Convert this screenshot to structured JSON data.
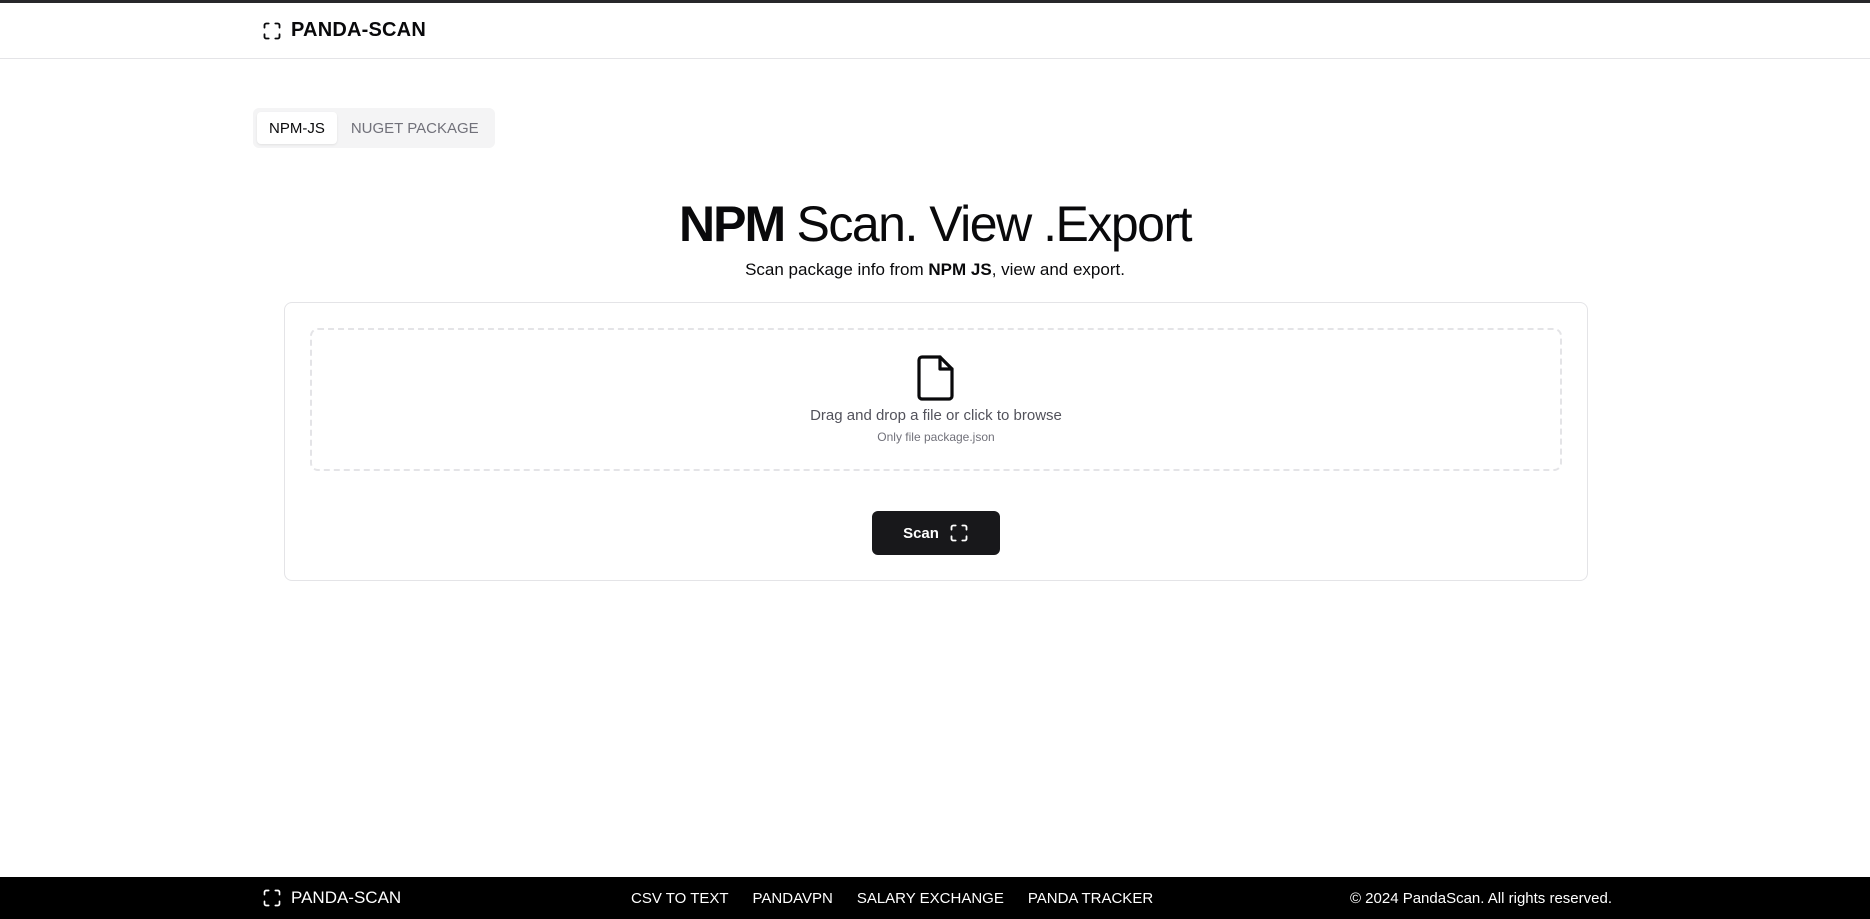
{
  "header": {
    "brand": "PANDA-SCAN",
    "brand_icon": "scan-frame-icon"
  },
  "tabs": [
    {
      "label": "NPM-JS",
      "active": true
    },
    {
      "label": "NUGET PACKAGE",
      "active": false
    }
  ],
  "hero": {
    "title_strong": "NPM",
    "title_rest": " Scan. View .Export",
    "subtitle_before": "Scan package info from ",
    "subtitle_strong": "NPM JS",
    "subtitle_after": ", view and export."
  },
  "dropzone": {
    "icon": "file-icon",
    "title": "Drag and drop a file or click to browse",
    "hint": "Only file package.json"
  },
  "scan_button": {
    "label": "Scan",
    "icon": "scan-frame-icon"
  },
  "footer": {
    "brand": "PANDA-SCAN",
    "links": [
      "CSV TO TEXT",
      "PANDAVPN",
      "SALARY EXCHANGE",
      "PANDA TRACKER"
    ],
    "copyright": "© 2024 PandaScan. All rights reserved."
  },
  "colors": {
    "primary": "#18181b",
    "border": "#e4e4e7",
    "muted_text": "#71717a",
    "footer_bg": "#000000"
  }
}
